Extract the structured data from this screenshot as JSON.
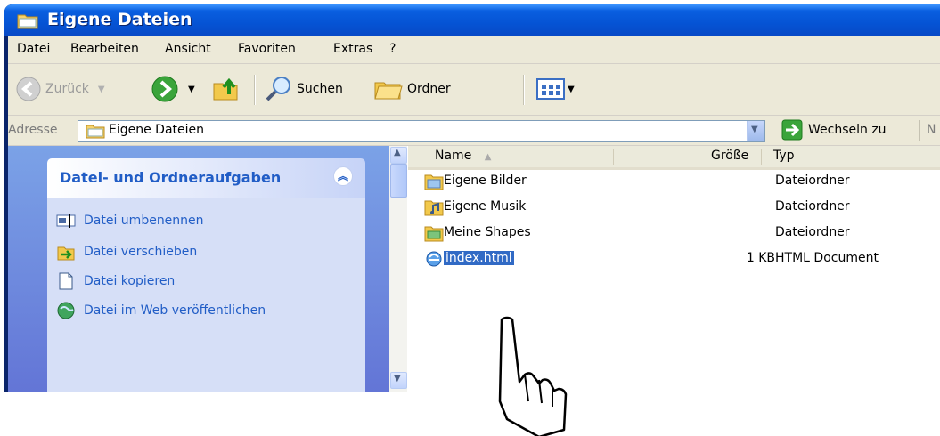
{
  "window": {
    "title": "Eigene Dateien"
  },
  "menu": [
    "Datei",
    "Bearbeiten",
    "Ansicht",
    "Favoriten",
    "Extras",
    "?"
  ],
  "toolbar": {
    "back_label": "Zurück",
    "search_label": "Suchen",
    "folders_label": "Ordner"
  },
  "address": {
    "label": "Adresse",
    "value": "Eigene Dateien",
    "go_label": "Wechseln zu",
    "cut_off": "N"
  },
  "taskpane": {
    "title": "Datei- und Ordneraufgaben",
    "tasks": [
      "Datei umbenennen",
      "Datei verschieben",
      "Datei kopieren",
      "Datei im Web veröffentlichen"
    ]
  },
  "filelist": {
    "columns": {
      "name": "Name",
      "size": "Größe",
      "type": "Typ"
    },
    "rows": [
      {
        "name": "Eigene Bilder",
        "size": "",
        "type": "Dateiordner"
      },
      {
        "name": "Eigene Musik",
        "size": "",
        "type": "Dateiordner"
      },
      {
        "name": "Meine Shapes",
        "size": "",
        "type": "Dateiordner"
      },
      {
        "name": "index.html",
        "size": "1 KB",
        "type": "HTML Document",
        "selected": true
      }
    ]
  },
  "colors": {
    "titlebar": "#0553d4",
    "taskpane_link": "#215dc6",
    "selection": "#316ac5"
  }
}
